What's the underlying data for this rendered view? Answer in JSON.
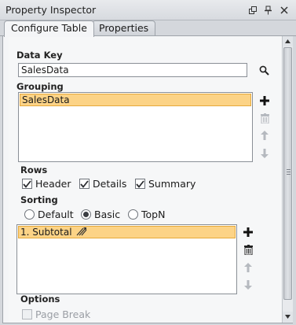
{
  "window": {
    "title": "Property Inspector"
  },
  "tabs": [
    {
      "label": "Configure Table",
      "active": true
    },
    {
      "label": "Properties",
      "active": false
    }
  ],
  "data_key": {
    "label": "Data Key",
    "value": "SalesData"
  },
  "grouping": {
    "label": "Grouping",
    "items": [
      "SalesData"
    ]
  },
  "rows": {
    "label": "Rows",
    "options": [
      {
        "label": "Header",
        "checked": true
      },
      {
        "label": "Details",
        "checked": true
      },
      {
        "label": "Summary",
        "checked": true
      }
    ]
  },
  "sorting": {
    "label": "Sorting",
    "options": [
      {
        "label": "Default",
        "selected": false
      },
      {
        "label": "Basic",
        "selected": true
      },
      {
        "label": "TopN",
        "selected": false
      }
    ],
    "items": [
      "1. Subtotal"
    ]
  },
  "options": {
    "label": "Options",
    "page_break": {
      "label": "Page Break",
      "checked": false,
      "disabled": true
    }
  },
  "colors": {
    "selection": "#fcd386",
    "selection_border": "#e6a93b",
    "add_icon": "#111111"
  }
}
